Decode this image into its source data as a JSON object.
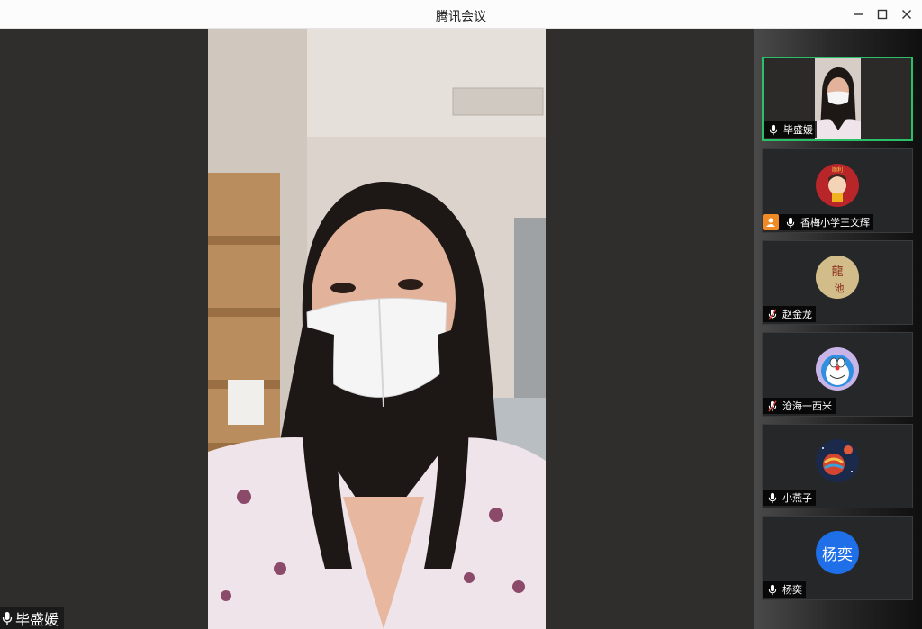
{
  "window": {
    "title": "腾讯会议",
    "minimize_icon": "minimize-icon",
    "maximize_icon": "maximize-icon",
    "close_icon": "close-icon"
  },
  "main_video": {
    "speaker_name": "毕盛媛",
    "mic_icon": "mic-icon"
  },
  "participants": [
    {
      "name": "毕盛媛",
      "mic": "on",
      "active": true,
      "avatar": "video-thumbnail"
    },
    {
      "name": "香梅小学王文辉",
      "mic": "on",
      "sharing": true,
      "avatar": "cartoon-girl-avatar"
    },
    {
      "name": "赵金龙",
      "mic": "muted",
      "avatar": "calligraphy-avatar"
    },
    {
      "name": "沧海一西米",
      "mic": "muted",
      "avatar": "doraemon-avatar"
    },
    {
      "name": "小燕子",
      "mic": "on",
      "avatar": "balloon-avatar"
    },
    {
      "name": "杨奕",
      "mic": "on",
      "avatar": "initials-avatar",
      "initials": "杨奕"
    }
  ],
  "colors": {
    "active_border": "#2bbf6a",
    "share_badge": "#f08a24",
    "initials_bg": "#1e6fe8"
  }
}
